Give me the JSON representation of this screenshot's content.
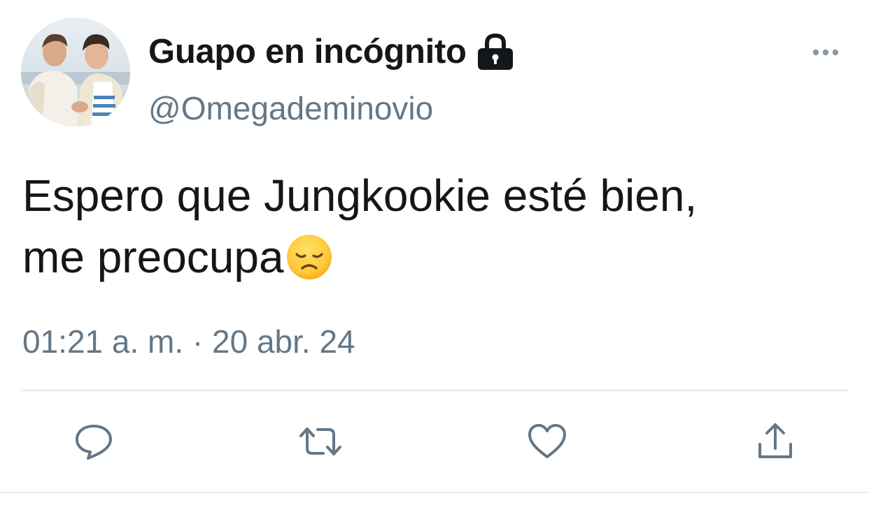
{
  "tweet": {
    "display_name": "Guapo en incógnito",
    "handle": "@Omegademinovio",
    "text_line1": "Espero que Jungkookie esté bien,",
    "text_line2": "me preocupa",
    "emoji": "disappointed-face-emoji",
    "timestamp": "01:21 a. m. · 20 abr. 24",
    "protected_icon": "lock-icon",
    "actions": [
      {
        "name": "reply",
        "icon": "reply-icon"
      },
      {
        "name": "retweet",
        "icon": "retweet-icon"
      },
      {
        "name": "like",
        "icon": "heart-icon"
      },
      {
        "name": "share",
        "icon": "share-icon"
      }
    ]
  },
  "colors": {
    "primary_text": "#14171a",
    "secondary_text": "#657786",
    "divider": "#e1e8ed"
  }
}
